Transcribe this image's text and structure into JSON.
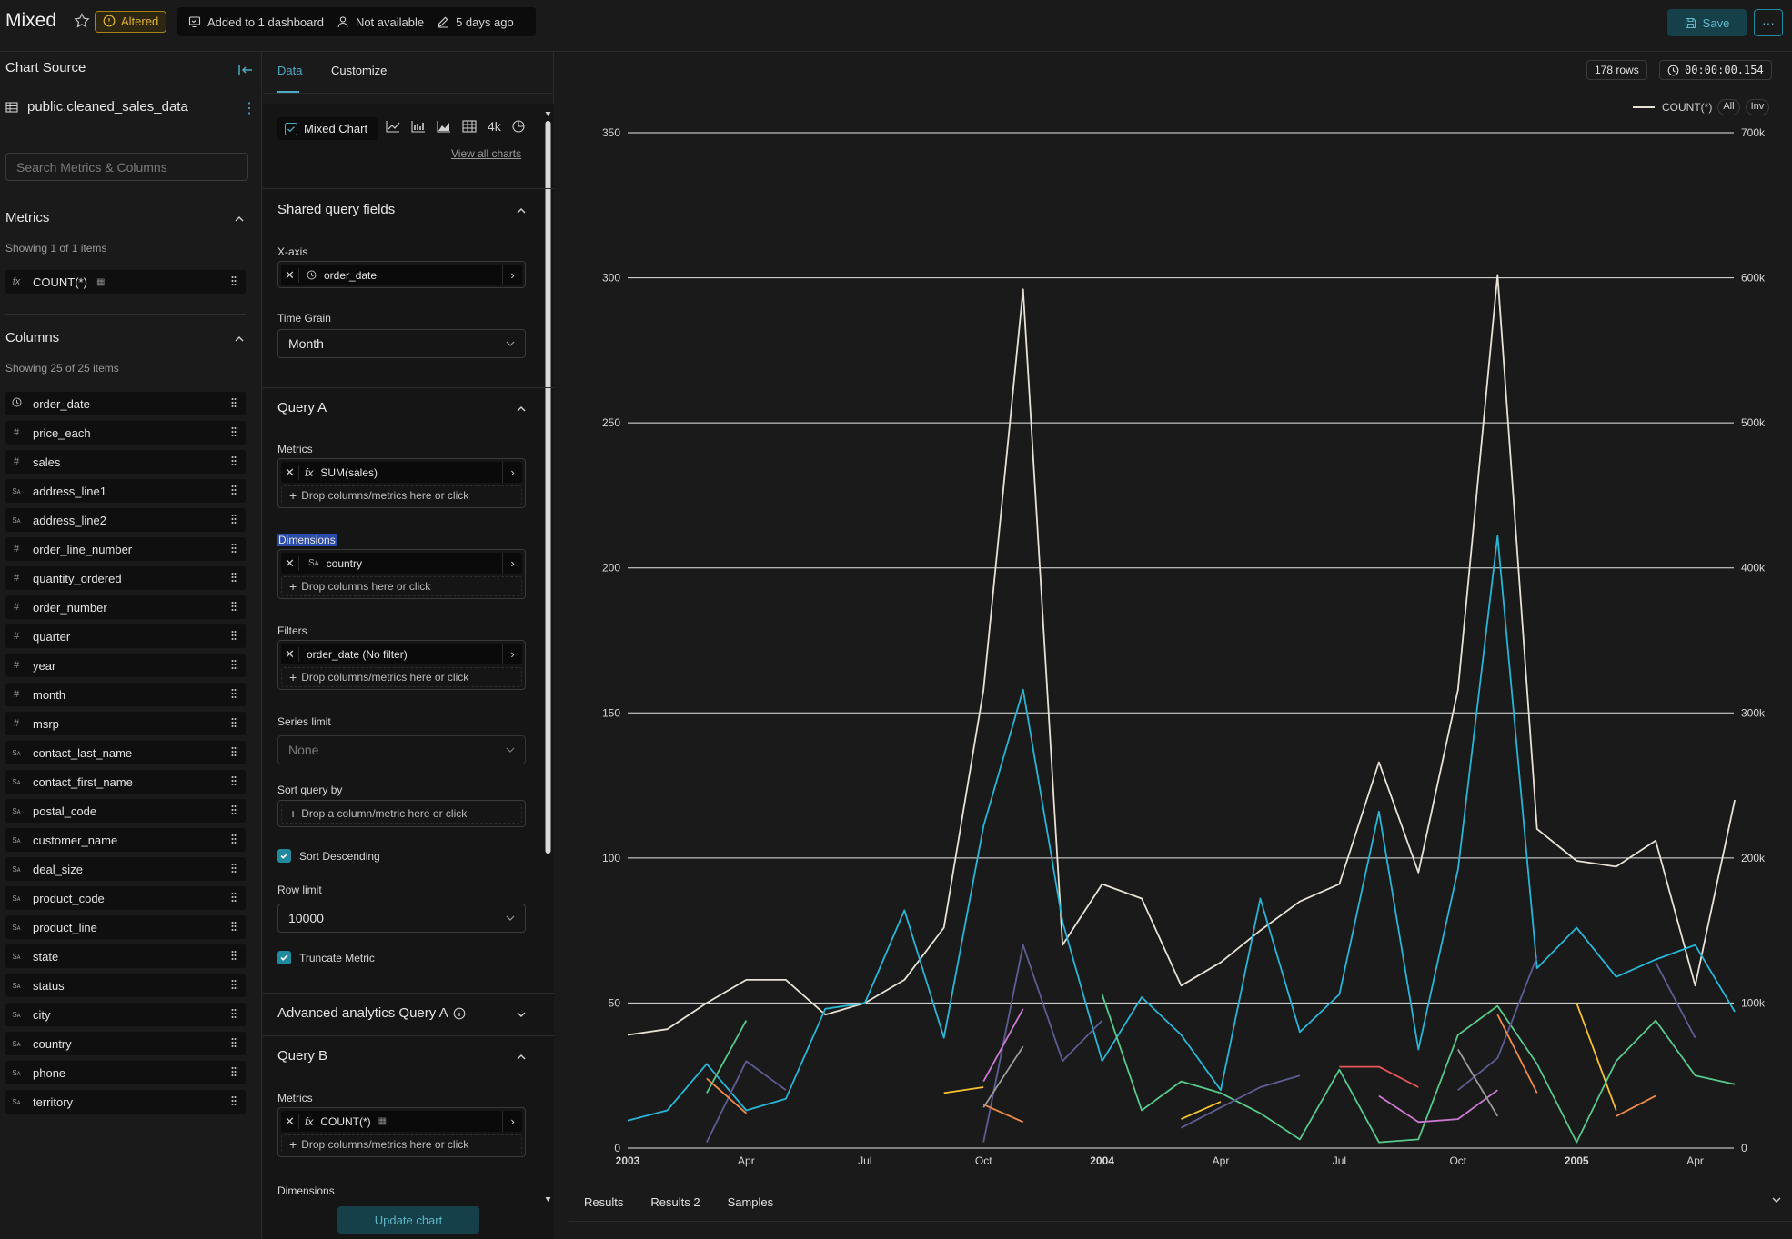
{
  "header": {
    "title": "Mixed",
    "altered": "Altered",
    "dashboards": "Added to 1 dashboard",
    "owner": "Not available",
    "modified": "5 days ago",
    "save": "Save",
    "more": "···"
  },
  "left": {
    "title": "Chart Source",
    "dataset": "public.cleaned_sales_data",
    "search_placeholder": "Search Metrics & Columns",
    "metrics_title": "Metrics",
    "metrics_showing": "Showing 1 of 1 items",
    "metrics": [
      {
        "icon": "fx",
        "label": "COUNT(*)"
      }
    ],
    "columns_title": "Columns",
    "columns_showing": "Showing 25 of 25 items",
    "columns": [
      {
        "icon": "clock",
        "label": "order_date"
      },
      {
        "icon": "#",
        "label": "price_each"
      },
      {
        "icon": "#",
        "label": "sales"
      },
      {
        "icon": "str",
        "label": "address_line1"
      },
      {
        "icon": "str",
        "label": "address_line2"
      },
      {
        "icon": "#",
        "label": "order_line_number"
      },
      {
        "icon": "#",
        "label": "quantity_ordered"
      },
      {
        "icon": "#",
        "label": "order_number"
      },
      {
        "icon": "#",
        "label": "quarter"
      },
      {
        "icon": "#",
        "label": "year"
      },
      {
        "icon": "#",
        "label": "month"
      },
      {
        "icon": "#",
        "label": "msrp"
      },
      {
        "icon": "str",
        "label": "contact_last_name"
      },
      {
        "icon": "str",
        "label": "contact_first_name"
      },
      {
        "icon": "str",
        "label": "postal_code"
      },
      {
        "icon": "str",
        "label": "customer_name"
      },
      {
        "icon": "str",
        "label": "deal_size"
      },
      {
        "icon": "str",
        "label": "product_code"
      },
      {
        "icon": "str",
        "label": "product_line"
      },
      {
        "icon": "str",
        "label": "state"
      },
      {
        "icon": "str",
        "label": "status"
      },
      {
        "icon": "str",
        "label": "city"
      },
      {
        "icon": "str",
        "label": "country"
      },
      {
        "icon": "str",
        "label": "phone"
      },
      {
        "icon": "str",
        "label": "territory"
      }
    ]
  },
  "mid": {
    "tab_data": "Data",
    "tab_customize": "Customize",
    "chart_type": "Mixed Chart",
    "chart_4k": "4k",
    "view_all": "View all charts",
    "shared_title": "Shared query fields",
    "xaxis_label": "X-axis",
    "xaxis_value": "order_date",
    "time_grain_label": "Time Grain",
    "time_grain_value": "Month",
    "queryA_title": "Query A",
    "metrics_label": "Metrics",
    "metricA_value": "SUM(sales)",
    "drop_cols_metrics": "Drop columns/metrics here or click",
    "dimensions_label": "Dimensions",
    "dimension_value": "country",
    "drop_cols": "Drop columns here or click",
    "filters_label": "Filters",
    "filter_value": "order_date (No filter)",
    "series_limit_label": "Series limit",
    "series_limit_value": "None",
    "sort_by_label": "Sort query by",
    "sort_by_drop": "Drop a column/metric here or click",
    "sort_desc": "Sort Descending",
    "row_limit_label": "Row limit",
    "row_limit_value": "10000",
    "truncate": "Truncate Metric",
    "adv_title": "Advanced analytics Query A",
    "queryB_title": "Query B",
    "metricB_value": "COUNT(*)",
    "dimensions_b_label": "Dimensions",
    "update": "Update chart"
  },
  "right": {
    "rows": "178 rows",
    "timer": "00:00:00.154",
    "legend_label": "COUNT(*)",
    "legend_all": "All",
    "legend_inv": "Inv",
    "tabs": [
      "Results",
      "Results 2",
      "Samples"
    ]
  },
  "colors": {
    "accent": "#1f8aa0",
    "count_line": "#e8e1d6",
    "sales_line": "#29b6d6"
  },
  "chart_data": {
    "type": "line",
    "x": [
      "2003-01",
      "2003-02",
      "2003-03",
      "2003-04",
      "2003-05",
      "2003-06",
      "2003-07",
      "2003-08",
      "2003-09",
      "2003-10",
      "2003-11",
      "2003-12",
      "2004-01",
      "2004-02",
      "2004-03",
      "2004-04",
      "2004-05",
      "2004-06",
      "2004-07",
      "2004-08",
      "2004-09",
      "2004-10",
      "2004-11",
      "2004-12",
      "2005-01",
      "2005-02",
      "2005-03",
      "2005-04",
      "2005-05"
    ],
    "x_ticks": [
      {
        "label": "2003",
        "x": "2003-01",
        "bold": true
      },
      {
        "label": "Apr",
        "x": "2003-04"
      },
      {
        "label": "Jul",
        "x": "2003-07"
      },
      {
        "label": "Oct",
        "x": "2003-10"
      },
      {
        "label": "2004",
        "x": "2004-01",
        "bold": true
      },
      {
        "label": "Apr",
        "x": "2004-04"
      },
      {
        "label": "Jul",
        "x": "2004-07"
      },
      {
        "label": "Oct",
        "x": "2004-10"
      },
      {
        "label": "2005",
        "x": "2005-01",
        "bold": true
      },
      {
        "label": "Apr",
        "x": "2005-04"
      }
    ],
    "y_left": {
      "ticks": [
        "0",
        "50",
        "100",
        "150",
        "200",
        "250",
        "300",
        "350"
      ],
      "range": [
        0,
        350
      ]
    },
    "y_right": {
      "ticks": [
        "0",
        "100k",
        "200k",
        "300k",
        "400k",
        "500k",
        "600k",
        "700k"
      ],
      "range": [
        0,
        700000
      ]
    },
    "series": [
      {
        "name": "COUNT(*)",
        "axis": "left",
        "color": "#e8e1d6",
        "values": [
          39,
          41,
          50,
          58,
          58,
          46,
          50,
          58,
          76,
          158,
          296,
          70,
          91,
          86,
          56,
          64,
          75,
          85,
          91,
          133,
          95,
          158,
          301,
          110,
          99,
          97,
          106,
          56,
          120
        ]
      },
      {
        "axis": "right",
        "color": "#29b6d6",
        "values": [
          19000,
          26000,
          58000,
          26000,
          34000,
          96000,
          100000,
          164000,
          76000,
          222000,
          316000,
          156000,
          60000,
          104000,
          78000,
          40000,
          172000,
          80000,
          106000,
          232000,
          68000,
          192000,
          422000,
          124000,
          152000,
          118000,
          130000,
          140000,
          94000
        ]
      },
      {
        "axis": "right",
        "color": "#56c98b",
        "values": [
          null,
          null,
          38000,
          88000,
          null,
          null,
          null,
          null,
          null,
          null,
          null,
          null,
          106000,
          26000,
          46000,
          38000,
          24000,
          6000,
          54000,
          4000,
          6000,
          78000,
          98000,
          58000,
          4000,
          60000,
          88000,
          50000,
          44000
        ]
      },
      {
        "axis": "right",
        "color": "#5d5d96",
        "values": [
          null,
          null,
          4000,
          60000,
          40000,
          null,
          null,
          null,
          null,
          4000,
          140000,
          60000,
          88000,
          null,
          14000,
          28000,
          42000,
          50000,
          null,
          null,
          null,
          40000,
          62000,
          132000,
          null,
          null,
          128000,
          76000,
          null
        ]
      },
      {
        "axis": "right",
        "color": "#f08b49",
        "values": [
          null,
          null,
          48000,
          24000,
          null,
          null,
          null,
          null,
          null,
          30000,
          18000,
          null,
          null,
          null,
          null,
          null,
          null,
          null,
          null,
          null,
          null,
          null,
          92000,
          38000,
          null,
          22000,
          36000,
          null,
          null
        ]
      },
      {
        "axis": "right",
        "color": "#f7c231",
        "values": [
          null,
          null,
          null,
          null,
          null,
          null,
          null,
          null,
          38000,
          42000,
          null,
          null,
          null,
          null,
          20000,
          32000,
          null,
          null,
          null,
          null,
          null,
          null,
          null,
          null,
          100000,
          26000,
          null,
          null,
          null
        ]
      },
      {
        "axis": "right",
        "color": "#cc79d4",
        "values": [
          null,
          null,
          null,
          null,
          null,
          null,
          null,
          null,
          null,
          46000,
          96000,
          null,
          null,
          null,
          null,
          null,
          null,
          null,
          null,
          36000,
          18000,
          20000,
          40000,
          null,
          null,
          null,
          null,
          null,
          null
        ]
      },
      {
        "axis": "right",
        "color": "#e85757",
        "values": [
          null,
          null,
          null,
          null,
          null,
          null,
          null,
          null,
          null,
          null,
          null,
          null,
          null,
          null,
          null,
          null,
          null,
          null,
          56000,
          56000,
          42000,
          null,
          null,
          null,
          null,
          null,
          null,
          null,
          null
        ]
      },
      {
        "axis": "right",
        "color": "#9a9a9a",
        "values": [
          null,
          null,
          null,
          null,
          null,
          null,
          null,
          null,
          null,
          28000,
          70000,
          null,
          null,
          null,
          null,
          null,
          null,
          null,
          null,
          null,
          null,
          68000,
          22000,
          null,
          null,
          null,
          null,
          null,
          null
        ]
      }
    ]
  }
}
